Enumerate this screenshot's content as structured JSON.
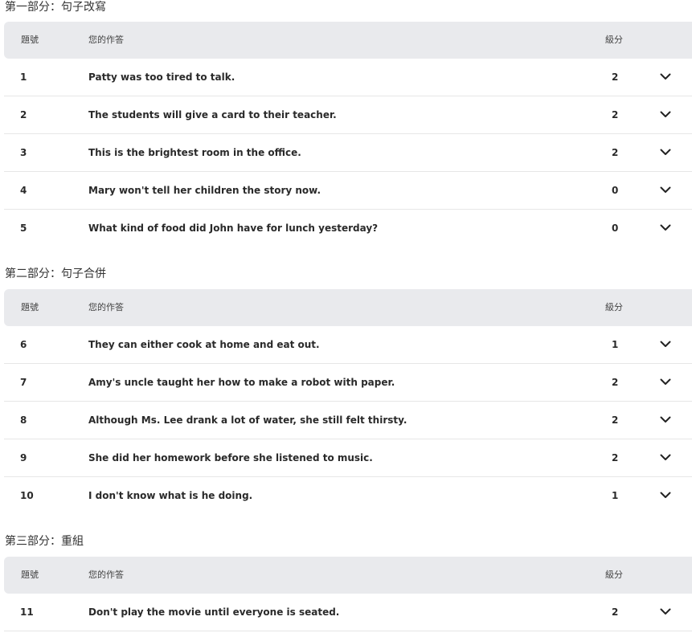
{
  "sections": [
    {
      "title": "第一部分：句子改寫",
      "headers": {
        "number": "題號",
        "answer": "您的作答",
        "score": "級分"
      },
      "rows": [
        {
          "number": "1",
          "answer": "Patty was too tired to talk.",
          "score": "2"
        },
        {
          "number": "2",
          "answer": "The students will give a card to their teacher.",
          "score": "2"
        },
        {
          "number": "3",
          "answer": "This is the brightest room in the office.",
          "score": "2"
        },
        {
          "number": "4",
          "answer": "Mary won't tell her children the story now.",
          "score": "0"
        },
        {
          "number": "5",
          "answer": "What kind of food did John have for lunch yesterday?",
          "score": "0"
        }
      ]
    },
    {
      "title": "第二部分：句子合併",
      "headers": {
        "number": "題號",
        "answer": "您的作答",
        "score": "級分"
      },
      "rows": [
        {
          "number": "6",
          "answer": "They can either cook at home and eat out.",
          "score": "1"
        },
        {
          "number": "7",
          "answer": "Amy's uncle taught her how to make a robot with paper.",
          "score": "2"
        },
        {
          "number": "8",
          "answer": "Although Ms. Lee drank a lot of water, she still felt thirsty.",
          "score": "2"
        },
        {
          "number": "9",
          "answer": "She did her homework before she listened to music.",
          "score": "2"
        },
        {
          "number": "10",
          "answer": "I don't know what is he doing.",
          "score": "1"
        }
      ]
    },
    {
      "title": "第三部分：重組",
      "headers": {
        "number": "題號",
        "answer": "您的作答",
        "score": "級分"
      },
      "rows": [
        {
          "number": "11",
          "answer": "Don't play the movie until everyone is seated.",
          "score": "2"
        }
      ]
    }
  ],
  "icons": {
    "expand": "chevron-down-icon"
  },
  "colors": {
    "header_bg": "#e9eaed",
    "row_divider": "#e6e6e6",
    "text": "#2a2a2a"
  }
}
